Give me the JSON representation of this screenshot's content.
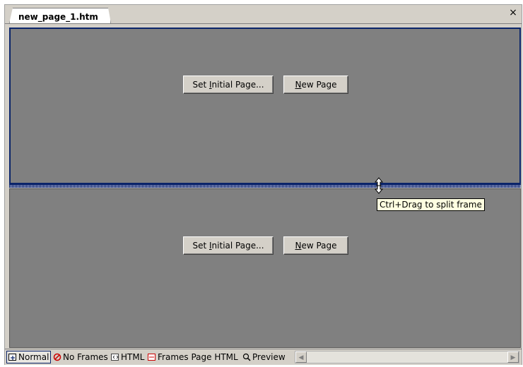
{
  "document_tab": {
    "title": "new_page_1.htm",
    "close_glyph": "×"
  },
  "frames": [
    {
      "set_initial_page": {
        "pre": "Set ",
        "accel": "I",
        "post": "nitial Page..."
      },
      "new_page": {
        "accel": "N",
        "post": "ew Page"
      }
    },
    {
      "set_initial_page": {
        "pre": "Set ",
        "accel": "I",
        "post": "nitial Page..."
      },
      "new_page": {
        "accel": "N",
        "post": "ew Page"
      }
    }
  ],
  "tooltip": "Ctrl+Drag to split frame",
  "view_tabs": [
    {
      "label": "Normal",
      "icon": "normal-view-icon",
      "active": true
    },
    {
      "label": "No Frames",
      "icon": "no-frames-icon",
      "active": false
    },
    {
      "label": "HTML",
      "icon": "html-view-icon",
      "active": false
    },
    {
      "label": "Frames Page HTML",
      "icon": "frames-page-html-icon",
      "active": false
    },
    {
      "label": "Preview",
      "icon": "preview-icon",
      "active": false
    }
  ],
  "scrollbar": {
    "left_arrow": "◀",
    "right_arrow": "▶"
  },
  "colors": {
    "frame_bg": "#808080",
    "selected_frame_border": "#0a246a",
    "tooltip_bg": "#ffffe1",
    "chrome": "#d4d0c8"
  }
}
